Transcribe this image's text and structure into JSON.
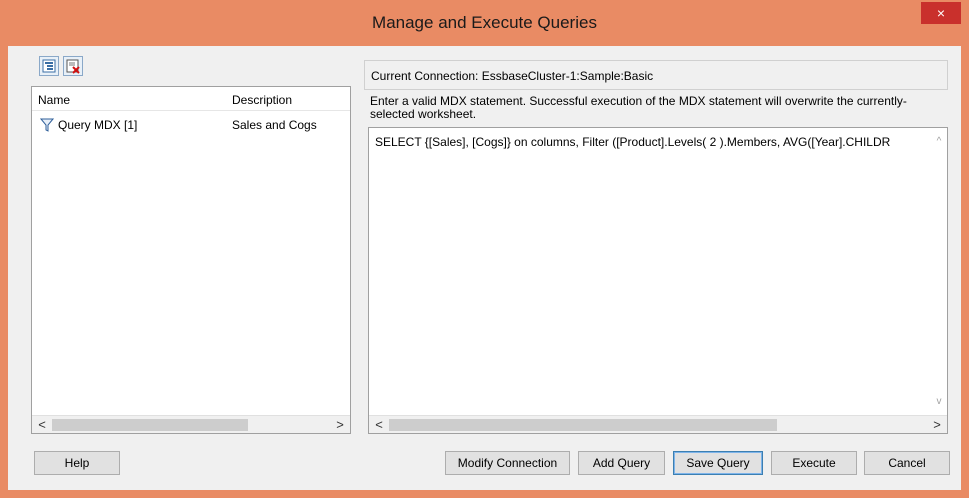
{
  "window": {
    "title": "Manage and Execute Queries",
    "close_glyph": "×"
  },
  "toolbar": {
    "icons": [
      "tree-view-icon",
      "delete-query-icon"
    ]
  },
  "tree": {
    "columns": {
      "name": "Name",
      "description": "Description"
    },
    "rows": [
      {
        "name": "Query MDX [1]",
        "description": "Sales and Cogs",
        "icon": "filter-funnel-icon"
      }
    ]
  },
  "connection": {
    "label": "Current Connection: EssbaseCluster-1:Sample:Basic"
  },
  "instructions": "Enter a valid MDX statement. Successful execution of the MDX statement will overwrite the currently-selected worksheet.",
  "mdx": {
    "statement": "SELECT {[Sales], [Cogs]} on columns, Filter ([Product].Levels( 2 ).Members, AVG([Year].CHILDR"
  },
  "buttons": {
    "help": "Help",
    "modify_connection": "Modify Connection",
    "add_query": "Add Query",
    "save_query": "Save Query",
    "execute": "Execute",
    "cancel": "Cancel"
  },
  "scroll": {
    "left": "<",
    "right": ">",
    "up": "^",
    "down": "v"
  },
  "colors": {
    "titlebar": "#e98b64",
    "close_button": "#c9302c",
    "client_bg": "#f0f0f0"
  }
}
